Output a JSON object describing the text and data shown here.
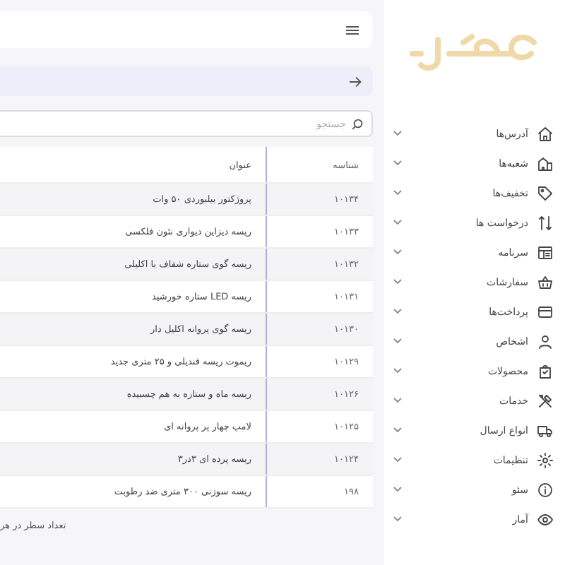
{
  "sidebar": {
    "items": [
      {
        "label": "آدرس‌ها",
        "expanded": false
      },
      {
        "label": "شعبه‌ها",
        "expanded": false
      },
      {
        "label": "تخفیف‌ها",
        "expanded": false
      },
      {
        "label": "درخواست ها",
        "expanded": false
      },
      {
        "label": "سرنامه",
        "expanded": false
      },
      {
        "label": "سفارشات",
        "expanded": false
      },
      {
        "label": "پرداخت‌ها",
        "expanded": false
      },
      {
        "label": "اشخاص",
        "expanded": false
      },
      {
        "label": "محصولات",
        "expanded": false
      },
      {
        "label": "خدمات",
        "expanded": false
      },
      {
        "label": "انواع ارسال",
        "expanded": false
      },
      {
        "label": "تنظیمات",
        "expanded": false
      },
      {
        "label": "سئو",
        "expanded": false
      },
      {
        "label": "آمار",
        "expanded": false
      }
    ]
  },
  "search": {
    "placeholder": "جستجو"
  },
  "table": {
    "columns": [
      "شناسه",
      "عنوان"
    ],
    "rows": [
      [
        "۱۰۱۳۴",
        "پروژکتور بیلبوردی ۵۰ وات"
      ],
      [
        "۱۰۱۳۳",
        "ریسه دیزاین دیواری نئون فلکسی"
      ],
      [
        "۱۰۱۳۲",
        "ریسه گوی ستاره شفاف با اکلیلی"
      ],
      [
        "۱۰۱۳۱",
        "ریسه LED ستاره خورشید"
      ],
      [
        "۱۰۱۳۰",
        "ریسه گوی پروانه اکلیل دار"
      ],
      [
        "۱۰۱۲۹",
        "ریموت ریسه قندیلی و ۲۵ متری جدید"
      ],
      [
        "۱۰۱۲۶",
        "ریسه ماه و ستاره به هم چسبیده"
      ],
      [
        "۱۰۱۲۵",
        "لامپ چهار پر پروانه ای"
      ],
      [
        "۱۰۱۲۴",
        "ریسه پرده ای ۳در۳"
      ],
      [
        "۱۹۸",
        "ریسه سوزنی ۳۰۰ متری ضد رطوبت"
      ]
    ]
  },
  "footer": {
    "rows_per_page_label": "تعداد سطر در هر"
  }
}
